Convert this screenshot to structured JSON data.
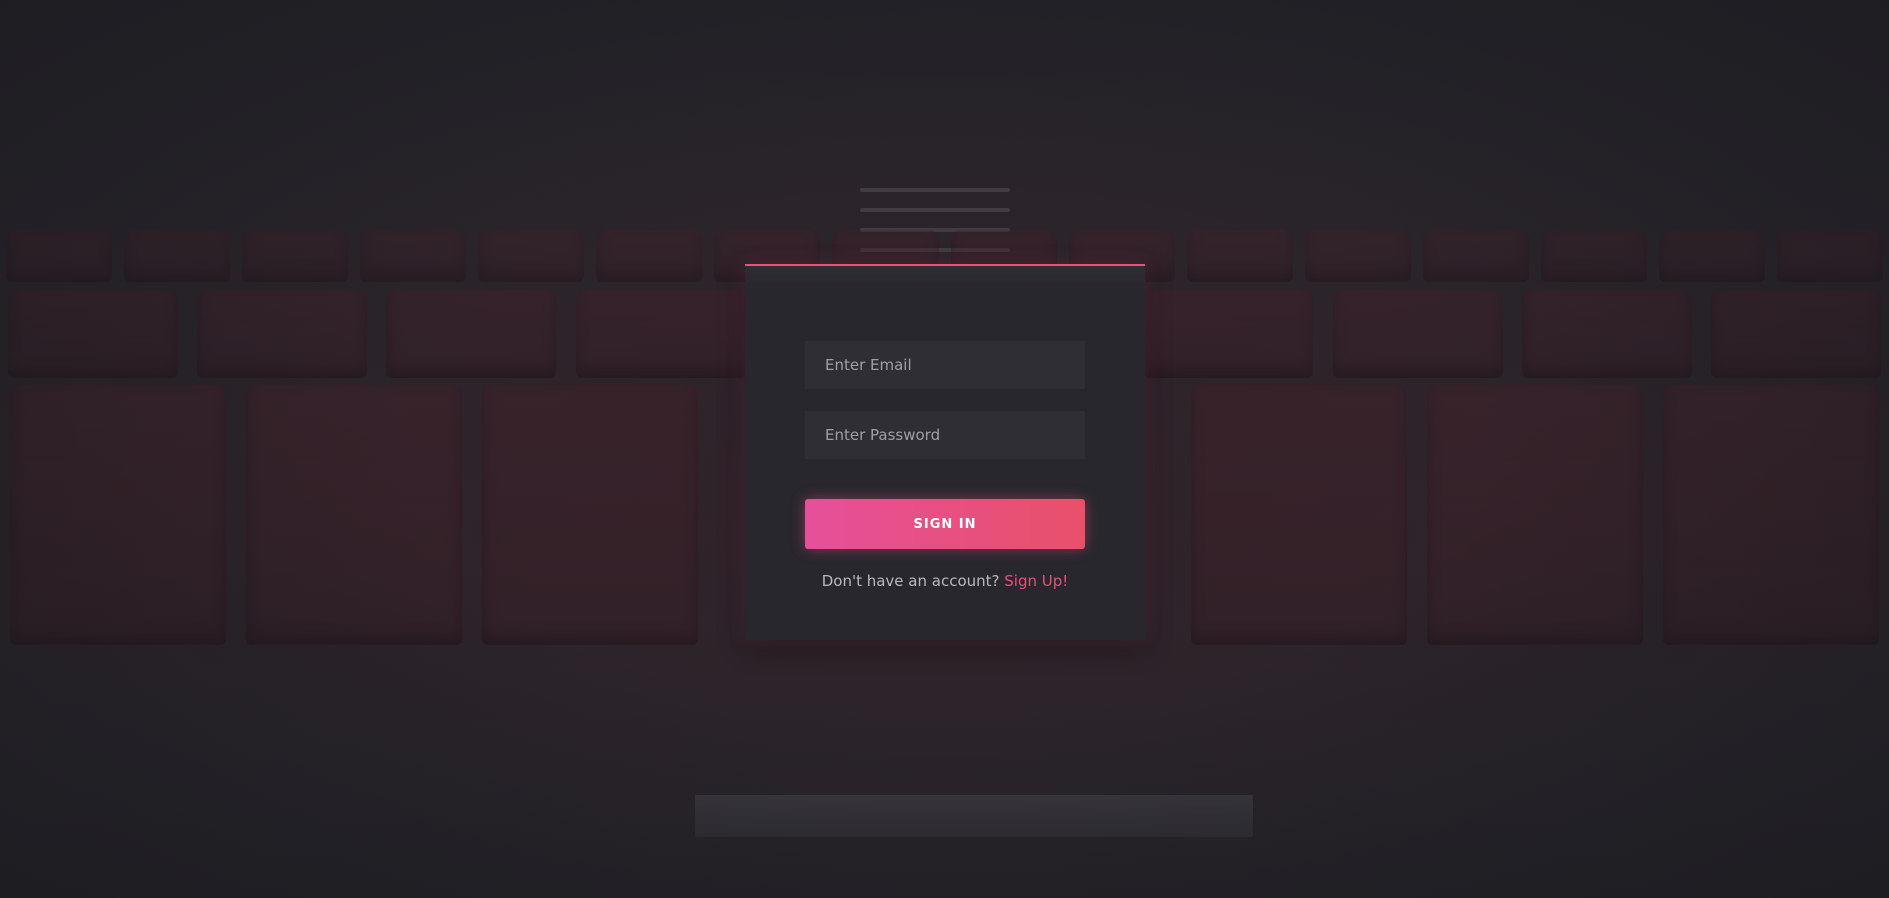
{
  "login": {
    "email_placeholder": "Enter Email",
    "password_placeholder": "Enter Password",
    "signin_label": "SIGN IN",
    "signup_prompt": "Don't have an account?",
    "signup_link": "Sign Up!"
  },
  "colors": {
    "accent": "#e8507a",
    "background": "#25242a",
    "card": "#28272d"
  }
}
